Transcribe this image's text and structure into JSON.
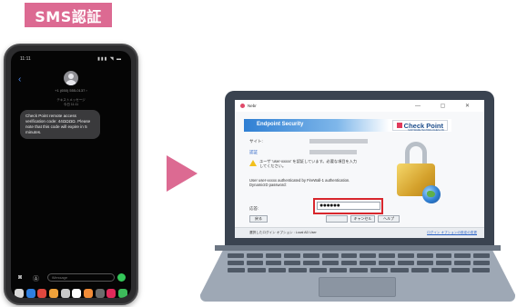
{
  "tag_label": "SMS認証",
  "phone": {
    "status_time": "11:11",
    "status_icons": "▮▮▮ ◥ ▬",
    "back_glyph": "‹",
    "sender": "+1 (650) 555-0137 ›",
    "stamp_line1": "テキストメッセージ",
    "stamp_line2": "今日 11:11",
    "message": "Check Point remote access verification code: 44ΩΩΩΩ. Please note that this code will expire in 5 minutes.",
    "compose_placeholder": "iMessage",
    "camera_glyph": "◙",
    "apps_glyph": "Ⓐ",
    "dock_colors": [
      "#d9d9d9",
      "#2f7fe0",
      "#e0483e",
      "#f0a23a",
      "#c9c9c9",
      "#ffffff",
      "#f28c38",
      "#6c6c6c",
      "#e02a5a",
      "#3dbb5b"
    ]
  },
  "laptop": {
    "dialog": {
      "window_title": "Nebr",
      "window_controls": "— ▢ ✕",
      "banner_title": "Endpoint Security",
      "logo_text": "Check Point",
      "logo_sub": "SOFTWARE TECHNOLOGIES LTD",
      "site_label": "サイト:",
      "user_label": "認証",
      "warning_text": "ユーザ 'user-xxxxx' を認証しています。必要な項目を入力してください。",
      "info_text": "User user-xxxxx authenticated by FireWall-1 authentication. DynamicID password:",
      "code_label": "応答:",
      "password_value": "●●●●●●",
      "btn_prev": "戻る",
      "btn_ok": "",
      "btn_cancel": "キャンセル",
      "btn_help": "ヘルプ",
      "footer_left": "選択したログイン オプション : Local AD User",
      "footer_right": "ログイン オプションの設定の変更"
    }
  }
}
